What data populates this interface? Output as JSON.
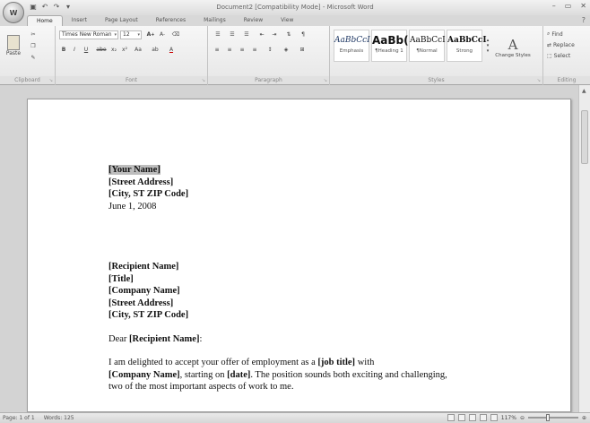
{
  "window": {
    "title": "Document2 [Compatibility Mode] - Microsoft Word",
    "office_button_label": "W"
  },
  "tabs": [
    "Home",
    "Insert",
    "Page Layout",
    "References",
    "Mailings",
    "Review",
    "View"
  ],
  "ribbon": {
    "clipboard": {
      "paste_label": "Paste",
      "group_label": "Clipboard"
    },
    "font": {
      "font_name": "Times New Roman",
      "font_size": "12",
      "group_label": "Font"
    },
    "paragraph": {
      "group_label": "Paragraph"
    },
    "styles": {
      "group_label": "Styles",
      "items": [
        {
          "sample": "AaBbCcI",
          "name": "Emphasis"
        },
        {
          "sample": "AaBb(",
          "name": "¶Heading 1"
        },
        {
          "sample": "AaBbCcI",
          "name": "¶Normal"
        },
        {
          "sample": "AaBbCcI",
          "name": "Strong"
        }
      ],
      "change_styles_label": "Change Styles"
    },
    "editing": {
      "group_label": "Editing",
      "find_label": "Find",
      "replace_label": "Replace",
      "select_label": "Select"
    }
  },
  "letter": {
    "sender": {
      "name": "[Your Name]",
      "street": "[Street Address]",
      "city": "[City, ST  ZIP Code]",
      "date": "June 1, 2008"
    },
    "recipient": {
      "name": "[Recipient Name]",
      "title": "[Title]",
      "company": "[Company Name]",
      "street": "[Street Address]",
      "city": "[City, ST  ZIP Code]"
    },
    "salutation_prefix": "Dear ",
    "salutation_name": "[Recipient Name]",
    "salutation_suffix": ":",
    "body": {
      "l1_a": "I am delighted to accept your offer of employment  as a ",
      "l1_b": "[job title]",
      "l1_c": " with",
      "l2_a": "[Company Name]",
      "l2_b": ", starting on ",
      "l2_c": "[date]",
      "l2_d": ". The position sounds both exciting  and challenging,",
      "l3": "two of the most important  aspects of work to me."
    }
  },
  "status": {
    "page": "Page: 1 of 1",
    "words": "Words: 125",
    "zoom": "117%"
  }
}
